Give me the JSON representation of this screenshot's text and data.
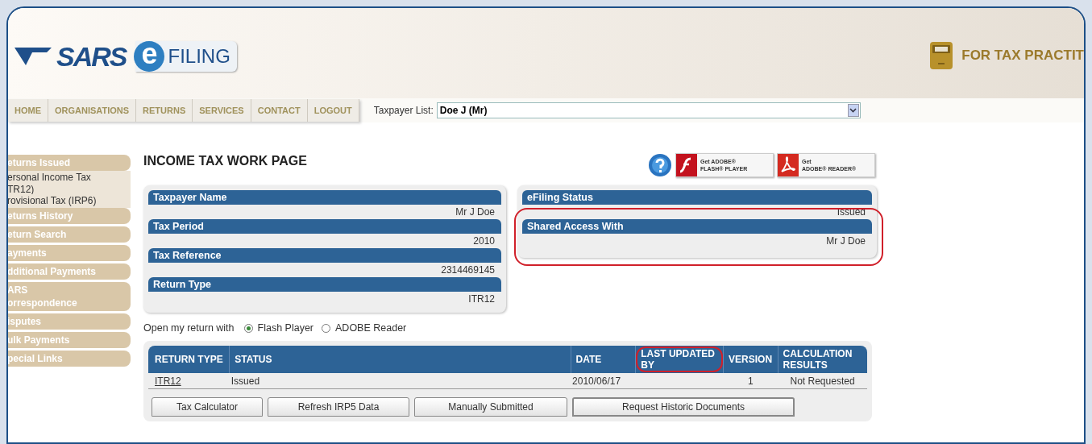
{
  "logo": {
    "brand": "SARS",
    "product_mark": "e",
    "product": "FILING"
  },
  "banner": {
    "label": "FOR TAX PRACTIT"
  },
  "nav": [
    {
      "label": "HOME"
    },
    {
      "label": "ORGANISATIONS"
    },
    {
      "label": "RETURNS"
    },
    {
      "label": "SERVICES"
    },
    {
      "label": "CONTACT"
    },
    {
      "label": "LOGOUT"
    }
  ],
  "taxpayer_list": {
    "label": "Taxpayer List:",
    "value": "Doe J (Mr)"
  },
  "sidebar": [
    {
      "kind": "header",
      "lines": [
        "eturns Issued"
      ]
    },
    {
      "kind": "link",
      "lines": [
        "ersonal Income Tax",
        "TR12)"
      ]
    },
    {
      "kind": "link",
      "lines": [
        "rovisional Tax (IRP6)"
      ]
    },
    {
      "kind": "header",
      "lines": [
        "eturns History"
      ]
    },
    {
      "kind": "header",
      "lines": [
        "eturn Search"
      ]
    },
    {
      "kind": "header",
      "lines": [
        "ayments"
      ]
    },
    {
      "kind": "header",
      "lines": [
        "dditional Payments"
      ]
    },
    {
      "kind": "header",
      "lines": [
        "ARS",
        "orrespondence"
      ]
    },
    {
      "kind": "header",
      "lines": [
        "isputes"
      ]
    },
    {
      "kind": "header",
      "lines": [
        "ulk Payments"
      ]
    },
    {
      "kind": "header",
      "lines": [
        "pecial Links"
      ]
    }
  ],
  "page_title": "INCOME TAX WORK PAGE",
  "badges": [
    {
      "kind": "help"
    },
    {
      "kind": "flash",
      "line_1": "Get ADOBE®",
      "line_2": "FLASH® PLAYER"
    },
    {
      "kind": "reader",
      "line_1": "Get",
      "line_2": "ADOBE® READER®"
    }
  ],
  "details": [
    {
      "label": "Taxpayer Name",
      "value": "Mr J Doe"
    },
    {
      "label": "Tax Period",
      "value": "2010"
    },
    {
      "label": "Tax Reference",
      "value": "2314469145"
    },
    {
      "label": "Return Type",
      "value": "ITR12"
    }
  ],
  "status_panel": [
    {
      "label": "eFiling Status",
      "value": "Issued",
      "highlighted": false
    },
    {
      "label": "Shared Access With",
      "value": "Mr J Doe",
      "highlighted": true
    }
  ],
  "open_with": {
    "label": "Open my return with",
    "options": [
      {
        "label": "Flash Player",
        "selected": true
      },
      {
        "label": "ADOBE Reader",
        "selected": false
      }
    ]
  },
  "table": {
    "columns": [
      {
        "label": "RETURN TYPE",
        "highlighted": false
      },
      {
        "label": "STATUS",
        "highlighted": false
      },
      {
        "label": "DATE",
        "highlighted": false
      },
      {
        "label": "LAST UPDATED BY",
        "highlighted": true
      },
      {
        "label": "VERSION",
        "highlighted": false
      },
      {
        "label": "CALCULATION RESULTS",
        "highlighted": false
      }
    ],
    "rows": [
      [
        "ITR12",
        "Issued",
        "2010/06/17",
        "",
        "1",
        "Not Requested"
      ]
    ]
  },
  "buttons": [
    "Tax Calculator",
    "Refresh IRP5 Data",
    "Manually Submitted",
    "Request Historic Documents"
  ]
}
